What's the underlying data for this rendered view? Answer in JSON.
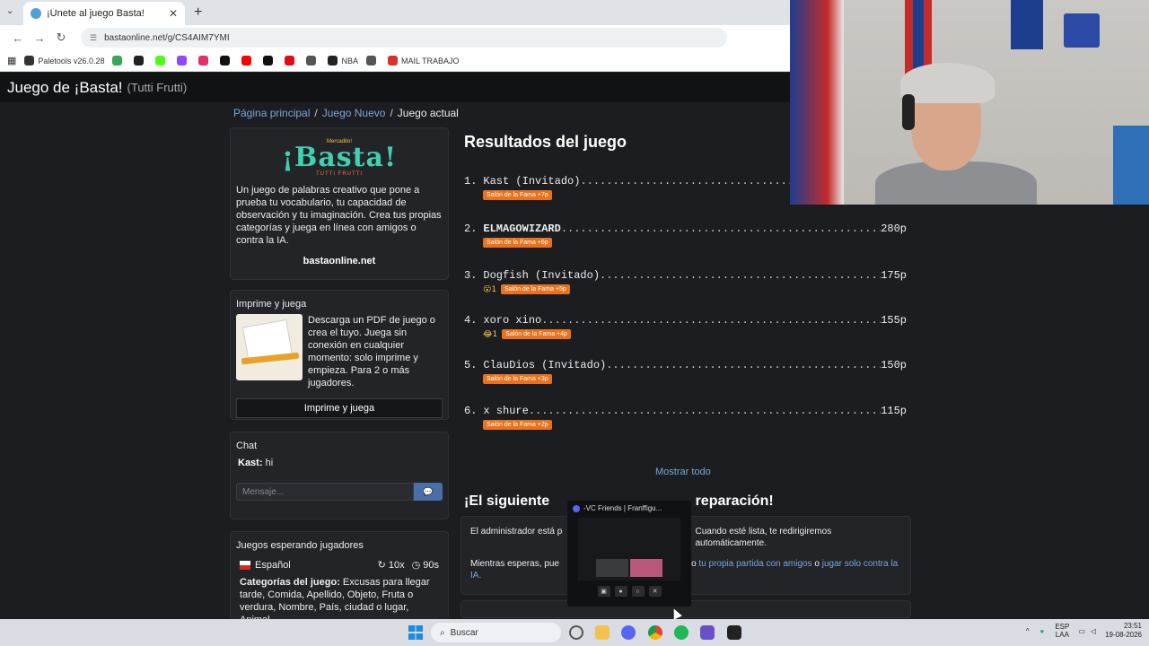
{
  "browser": {
    "tab_title": "¡Únete al juego Basta!",
    "new_tab": "+",
    "url": "bastaonline.net/g/CS4AIM7YMI",
    "bookmarks": [
      {
        "label": "Paletools v26.0.28",
        "color": "#333333"
      },
      {
        "label": "",
        "color": "#3aa757"
      },
      {
        "label": "",
        "color": "#222222"
      },
      {
        "label": "",
        "color": "#53fc18"
      },
      {
        "label": "",
        "color": "#9146ff"
      },
      {
        "label": "",
        "color": "#e1306c"
      },
      {
        "label": "",
        "color": "#111111"
      },
      {
        "label": "",
        "color": "#ff0000"
      },
      {
        "label": "",
        "color": "#111111"
      },
      {
        "label": "",
        "color": "#e50914"
      },
      {
        "label": "",
        "color": "#555555"
      },
      {
        "label": "NBA",
        "color": "#222222"
      },
      {
        "label": "",
        "color": "#555555"
      },
      {
        "label": "MAIL TRABAJO",
        "color": "#d93025"
      }
    ]
  },
  "site": {
    "title": "Juego de ¡Basta!",
    "subtitle": "(Tutti Frutti)"
  },
  "breadcrumb": {
    "home": "Página principal",
    "new_game": "Juego Nuevo",
    "current": "Juego actual",
    "sep": "/"
  },
  "about": {
    "logo_small": "Mercadito!",
    "logo_big": "¡Basta!",
    "logo_sub": "TUTTI FRUTTI",
    "description": "Un juego de palabras creativo que pone a prueba tu vocabulario, tu capacidad de observación y tu imaginación. Crea tus propias categorías y juega en línea con amigos o contra la IA.",
    "site": "bastaonline.net"
  },
  "print": {
    "heading": "Imprime y juega",
    "text": "Descarga un PDF de juego o crea el tuyo. Juega sin conexión en cualquier momento: solo imprime y empieza. Para 2 o más jugadores.",
    "button": "Imprime y juega"
  },
  "chat": {
    "heading": "Chat",
    "messages": [
      {
        "user": "Kast:",
        "text": "hi"
      }
    ],
    "placeholder": "Mensaje..."
  },
  "lobby": {
    "heading": "Juegos esperando jugadores",
    "language": "Español",
    "rounds": "10x",
    "time": "90s",
    "categories_label": "Categorías del juego:",
    "categories": "Excusas para llegar tarde, Comida, Apellido, Objeto, Fruta o verdura, Nombre, País, ciudad o lugar, Animal,"
  },
  "results": {
    "title": "Resultados del juego",
    "entries": [
      {
        "rank": "1.",
        "name": "Kast (Invitado)",
        "points": "",
        "emoji": "",
        "fame": "Salón de la Fama +7p"
      },
      {
        "rank": "2.",
        "name": "ELMAGOWIZARD",
        "points": "280p",
        "emoji": "",
        "fame": "Salón de la Fama +6p"
      },
      {
        "rank": "3.",
        "name": "Dogfish (Invitado)",
        "points": "175p",
        "emoji": "😮1",
        "fame": "Salón de la Fama +5p"
      },
      {
        "rank": "4.",
        "name": "xoro xino",
        "points": "155p",
        "emoji": "😂1",
        "fame": "Salón de la Fama +4p"
      },
      {
        "rank": "5.",
        "name": "ClauDios (Invitado)",
        "points": "150p",
        "emoji": "",
        "fame": "Salón de la Fama +3p"
      },
      {
        "rank": "6.",
        "name": "x shure",
        "points": "115p",
        "emoji": "",
        "fame": "Salón de la Fama +2p"
      }
    ],
    "show_all": "Mostrar todo"
  },
  "next": {
    "title_left": "¡El siguiente",
    "title_right": "reparación!",
    "p1_left": "El administrador está p",
    "p1_right": "Cuando esté lista, te redirigiremos automáticamente.",
    "p2_left": "Mientras esperas, pue",
    "p2_mid": "nto",
    "p2_link1": "tu propia partida con amigos",
    "p2_or": "o",
    "p2_link2": "jugar solo contra la IA."
  },
  "overlay": {
    "title": "-VC Friends | Franffigu..."
  },
  "taskbar": {
    "search": "Buscar",
    "lang1": "ESP",
    "lang2": "LAA",
    "time": "23:51",
    "date": "19-08-2026"
  }
}
